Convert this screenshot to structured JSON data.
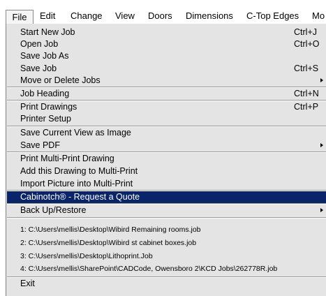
{
  "menubar": {
    "items": [
      {
        "label": "File"
      },
      {
        "label": "Edit"
      },
      {
        "label": "Change"
      },
      {
        "label": "View"
      },
      {
        "label": "Doors"
      },
      {
        "label": "Dimensions"
      },
      {
        "label": "C-Top Edges"
      },
      {
        "label": "Mo"
      }
    ],
    "active": "File"
  },
  "file_menu": {
    "items": [
      {
        "label": "Start New Job",
        "shortcut": "Ctrl+J"
      },
      {
        "label": "Open Job",
        "shortcut": "Ctrl+O"
      },
      {
        "label": "Save Job As",
        "shortcut": ""
      },
      {
        "label": "Save Job",
        "shortcut": "Ctrl+S"
      },
      {
        "label": "Move or Delete Jobs",
        "submenu": true
      },
      {
        "label": "Job Heading",
        "shortcut": "Ctrl+N"
      },
      {
        "label": "Print Drawings",
        "shortcut": "Ctrl+P"
      },
      {
        "label": "Printer Setup",
        "shortcut": ""
      },
      {
        "label": "Save Current View as Image",
        "shortcut": ""
      },
      {
        "label": "Save PDF",
        "submenu": true
      },
      {
        "label": "Print Multi-Print Drawing",
        "shortcut": ""
      },
      {
        "label": "Add this Drawing to Multi-Print",
        "shortcut": ""
      },
      {
        "label": "Import Picture into Multi-Print",
        "shortcut": ""
      },
      {
        "label": "Cabinotch® - Request a Quote",
        "highlighted": true
      },
      {
        "label": "Back Up/Restore",
        "submenu": true
      },
      {
        "label": "1:  C:\\Users\\mellis\\Desktop\\Wibird Remaining rooms.job"
      },
      {
        "label": "2:  C:\\Users\\mellis\\Desktop\\Wibird st cabinet boxes.job"
      },
      {
        "label": "3:  C:\\Users\\mellis\\Desktop\\Lithoprint.Job"
      },
      {
        "label": "4:  C:\\Users\\mellis\\SharePoint\\CADCode, Owensboro 2\\KCD Jobs\\262778R.job"
      },
      {
        "label": "Exit"
      }
    ]
  },
  "colors": {
    "menu_background": "#e4e4e4",
    "highlight": "#0a246a",
    "highlight_text": "#ffffff"
  }
}
